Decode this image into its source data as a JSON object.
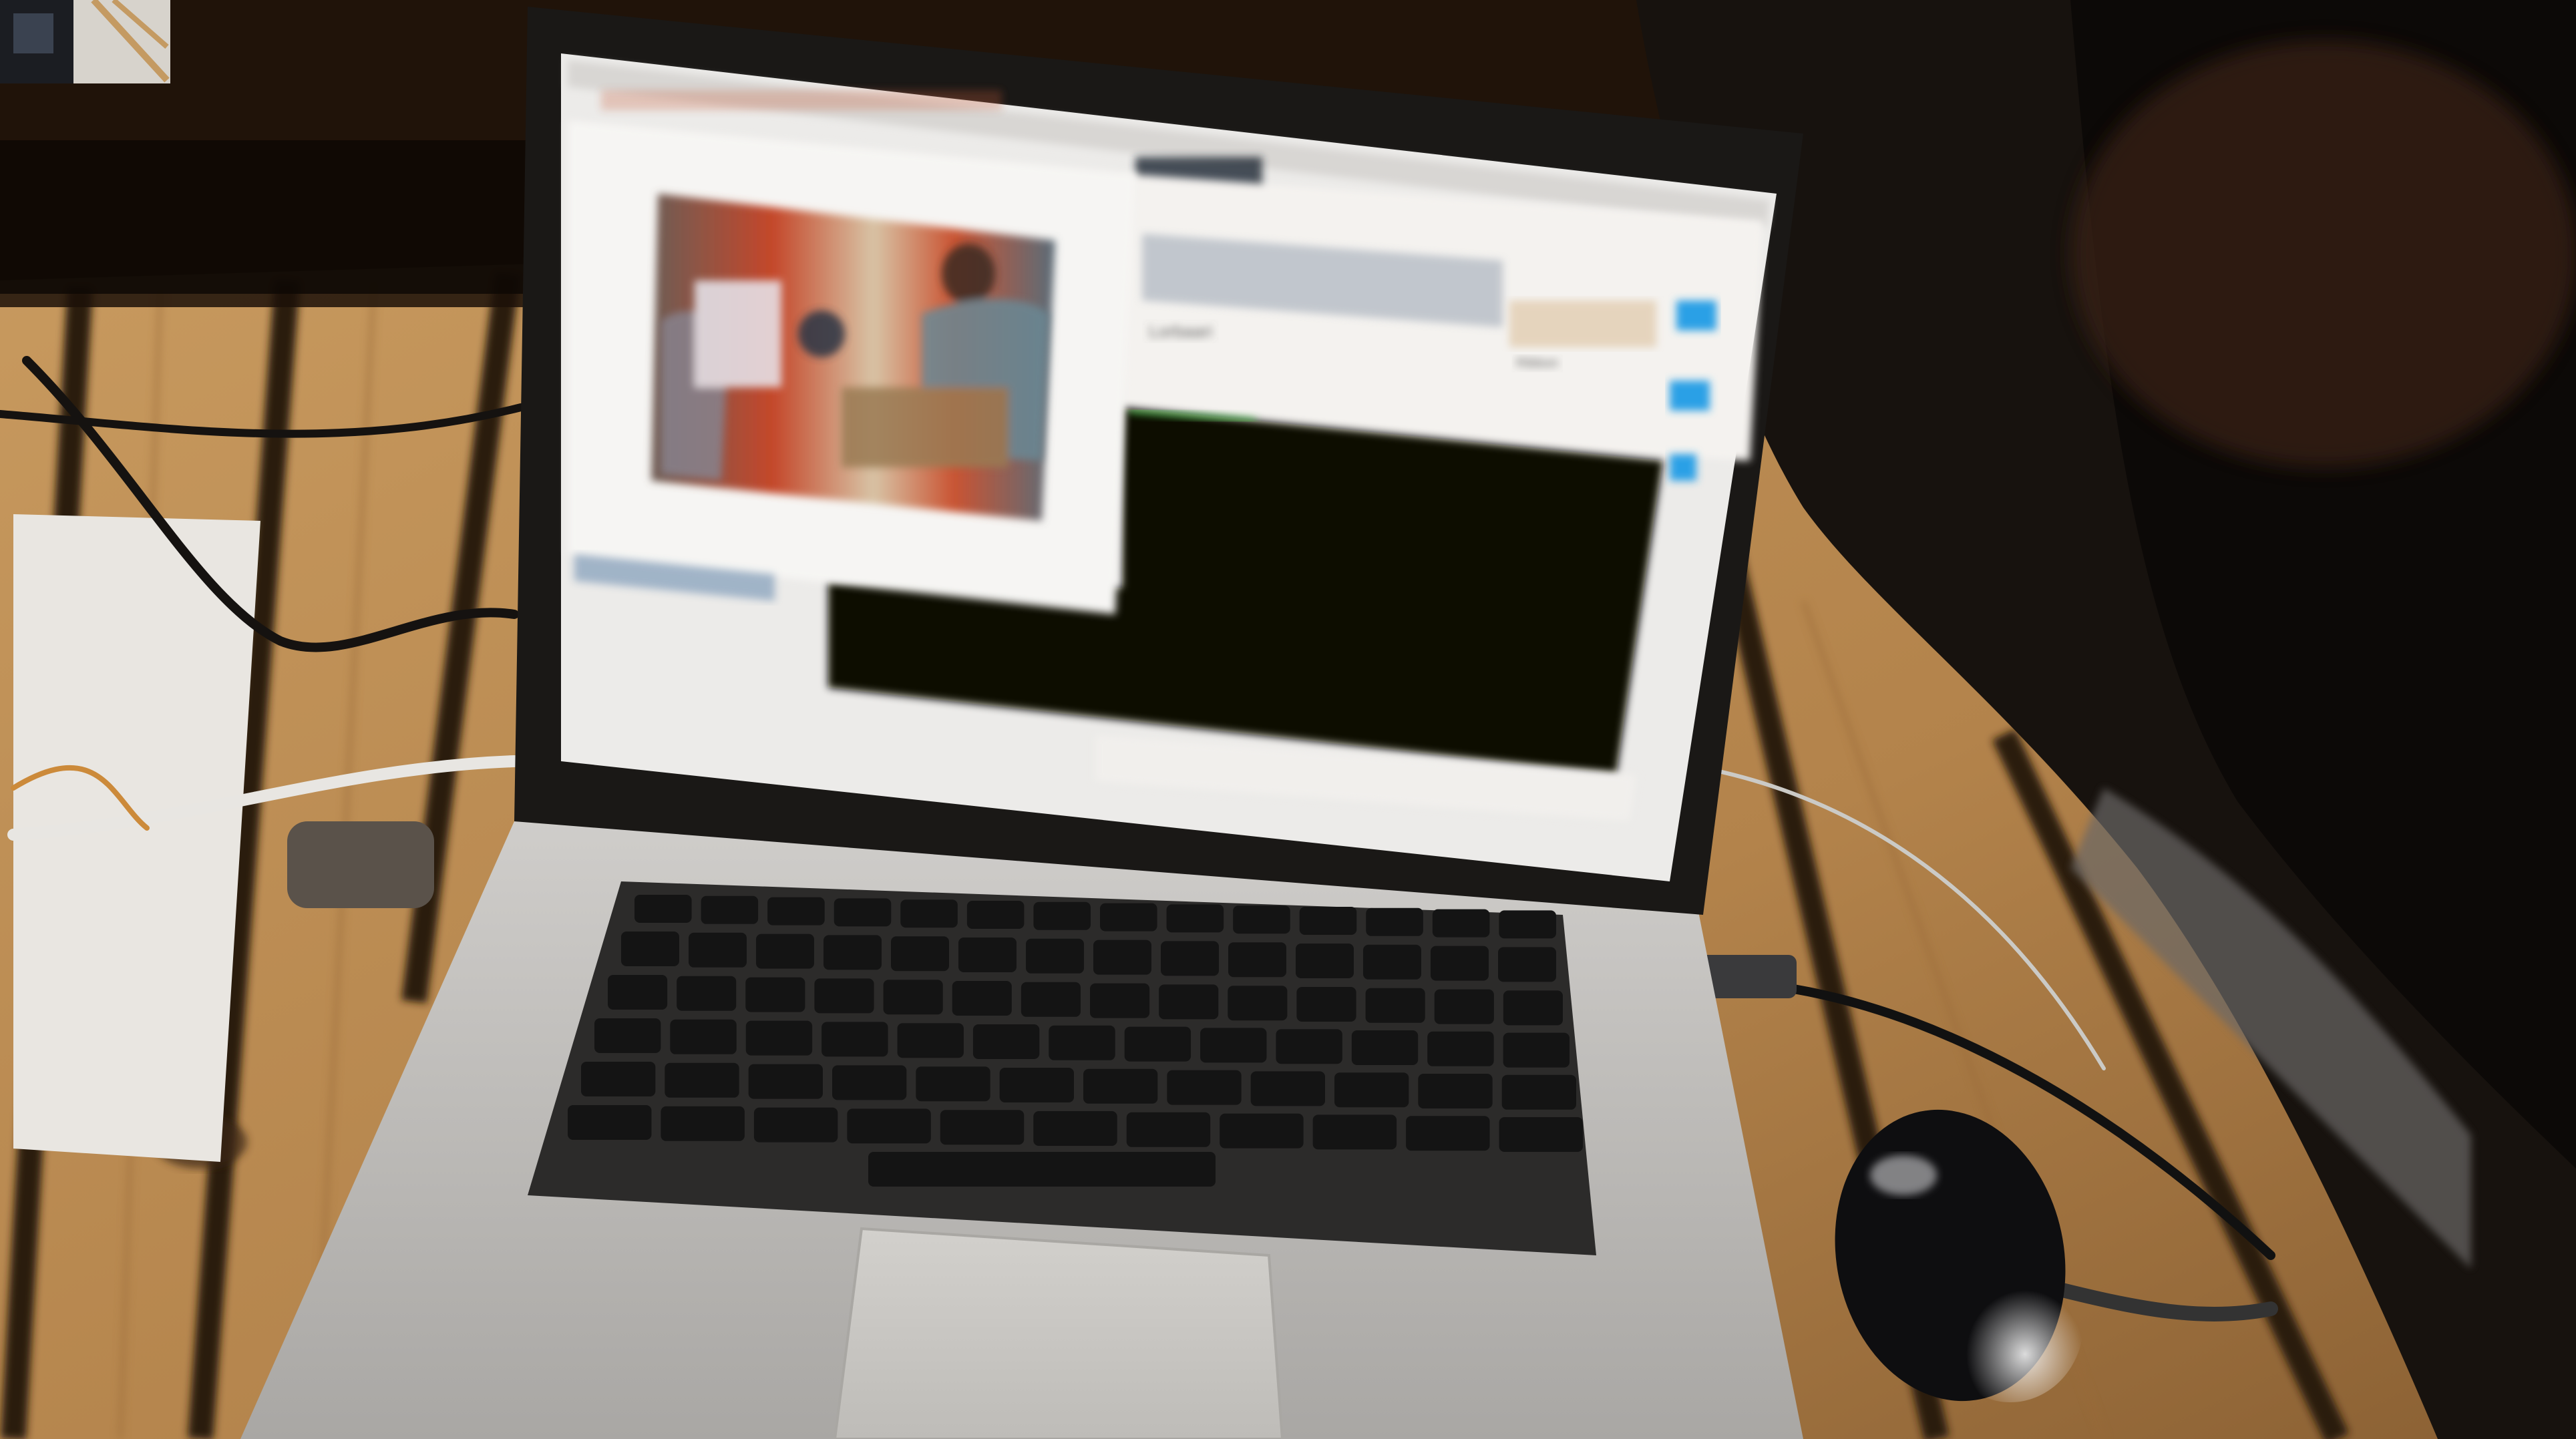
{
  "screen": {
    "document_title": "Lorbaari",
    "document_line": "",
    "panel_heading": "Ribbon",
    "colors": {
      "terminal": "#0b0806",
      "accent_blue": "#2aa0e6",
      "window_white": "#f4f2ef",
      "screen_bg": "#ecebe9"
    }
  },
  "scene": {
    "colors": {
      "table_wood": "#b98a52",
      "table_shadow": "#3a2512",
      "laptop_body": "#b9b7b4",
      "keyboard_keys": "#141414",
      "mouse": "#0e0e10",
      "bag": "#17120e",
      "wall_dark": "#26170b"
    },
    "objects": [
      "macbook-pro-laptop",
      "black-mouse",
      "wooden-table",
      "cables",
      "paper-sheet",
      "black-bag",
      "photo-inset-thumbnail"
    ]
  }
}
